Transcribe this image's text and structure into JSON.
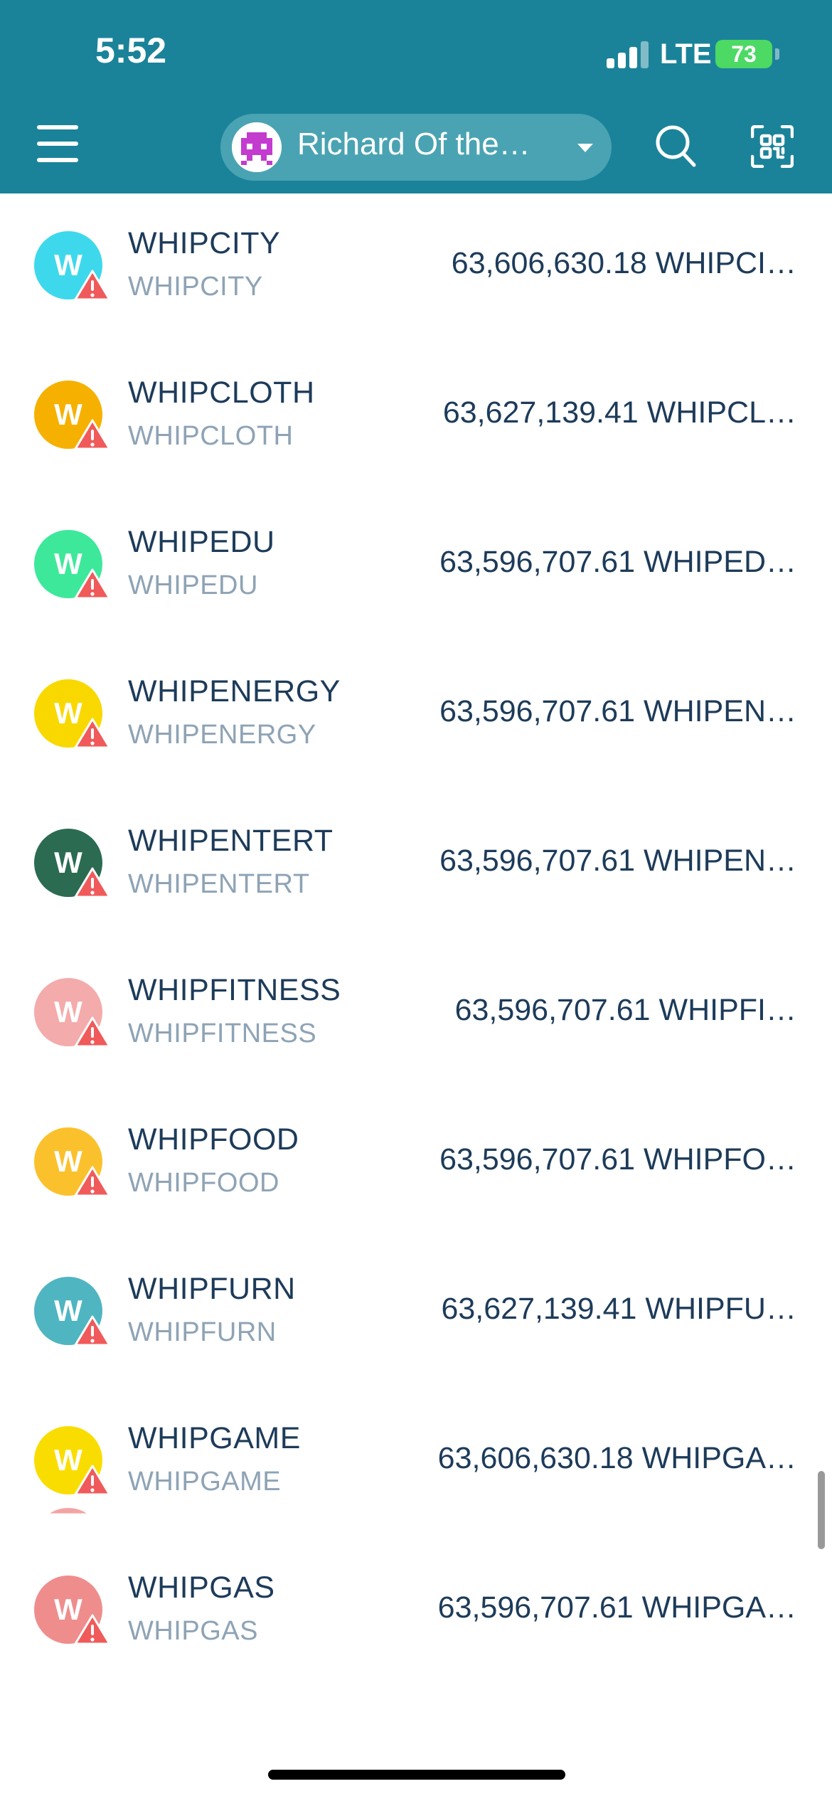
{
  "status_bar": {
    "time": "5:52",
    "network": "LTE",
    "battery": "73"
  },
  "header": {
    "account_name": "Richard Of the…",
    "menu_icon": "hamburger-menu-icon",
    "search_icon": "search-icon",
    "scan_icon": "qr-scan-icon"
  },
  "tokens": [
    {
      "initial": "W",
      "name": "WHIPCITY",
      "symbol": "WHIPCITY",
      "balance": "63,606,630.18 WHIPCI…",
      "color": "#3ed8ec"
    },
    {
      "initial": "W",
      "name": "WHIPCLOTH",
      "symbol": "WHIPCLOTH",
      "balance": "63,627,139.41 WHIPCL…",
      "color": "#f6b100"
    },
    {
      "initial": "W",
      "name": "WHIPEDU",
      "symbol": "WHIPEDU",
      "balance": "63,596,707.61 WHIPED…",
      "color": "#3ee89b"
    },
    {
      "initial": "W",
      "name": "WHIPENERGY",
      "symbol": "WHIPENERGY",
      "balance": "63,596,707.61 WHIPEN…",
      "color": "#f9d800"
    },
    {
      "initial": "W",
      "name": "WHIPENTERT",
      "symbol": "WHIPENTERT",
      "balance": "63,596,707.61 WHIPEN…",
      "color": "#2b6b52"
    },
    {
      "initial": "W",
      "name": "WHIPFITNESS",
      "symbol": "WHIPFITNESS",
      "balance": "63,596,707.61 WHIPFI…",
      "color": "#f4abab"
    },
    {
      "initial": "W",
      "name": "WHIPFOOD",
      "symbol": "WHIPFOOD",
      "balance": "63,596,707.61 WHIPFO…",
      "color": "#fbc12d"
    },
    {
      "initial": "W",
      "name": "WHIPFURN",
      "symbol": "WHIPFURN",
      "balance": "63,627,139.41 WHIPFU…",
      "color": "#4fb5c1"
    },
    {
      "initial": "W",
      "name": "WHIPGAME",
      "symbol": "WHIPGAME",
      "balance": "63,606,630.18 WHIPGA…",
      "color": "#fadd00"
    },
    {
      "initial": "W",
      "name": "WHIPGAS",
      "symbol": "WHIPGAS",
      "balance": "63,596,707.61 WHIPGA…",
      "color": "#ef8d8d"
    }
  ],
  "warning_icon": "warning-triangle-icon",
  "colors": {
    "header": "#1a8399",
    "pill": "#4aa3b3",
    "text_primary": "#1d3b5a",
    "text_secondary": "#8ea3b5",
    "warning": "#f05a5a"
  }
}
